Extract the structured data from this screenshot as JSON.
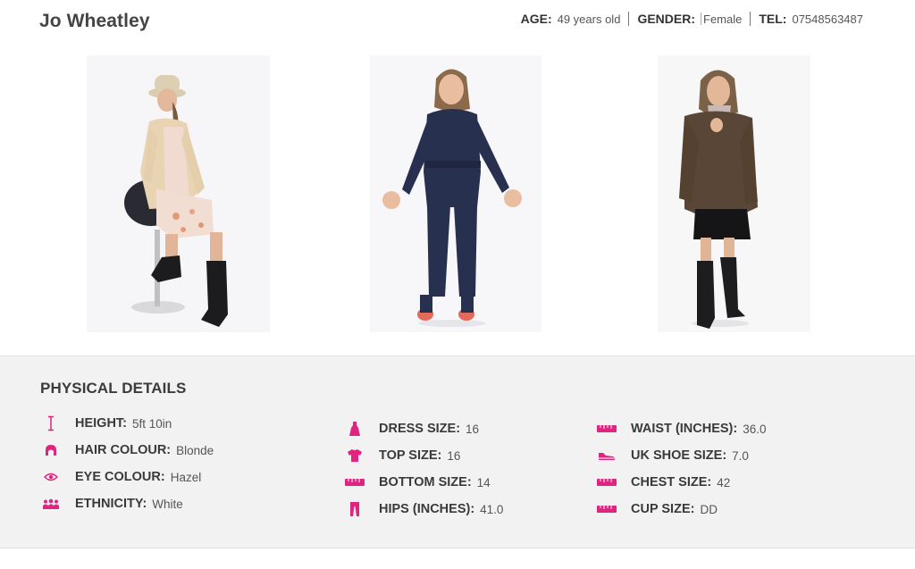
{
  "profile": {
    "name": "Jo Wheatley",
    "age_label": "AGE:",
    "age_value": "49 years old",
    "gender_label": "GENDER:",
    "gender_value": "Female",
    "tel_label": "TEL:",
    "tel_value": "07548563487"
  },
  "photos": [
    {
      "name": "photo-seated"
    },
    {
      "name": "photo-jumpsuit"
    },
    {
      "name": "photo-jacket"
    }
  ],
  "details": {
    "title": "PHYSICAL DETAILS",
    "col1": [
      {
        "label": "HEIGHT:",
        "value": "5ft 10in",
        "icon": "height-icon"
      },
      {
        "label": "HAIR COLOUR:",
        "value": "Blonde",
        "icon": "hair-icon"
      },
      {
        "label": "EYE COLOUR:",
        "value": "Hazel",
        "icon": "eye-icon"
      },
      {
        "label": "ETHNICITY:",
        "value": "White",
        "icon": "people-icon"
      }
    ],
    "col2": [
      {
        "label": "DRESS SIZE:",
        "value": "16",
        "icon": "dress-icon"
      },
      {
        "label": "TOP SIZE:",
        "value": "16",
        "icon": "shirt-icon"
      },
      {
        "label": "BOTTOM SIZE:",
        "value": "14",
        "icon": "tape-measure-icon"
      },
      {
        "label": "HIPS (INCHES):",
        "value": "41.0",
        "icon": "trousers-icon"
      }
    ],
    "col3": [
      {
        "label": "WAIST (INCHES):",
        "value": "36.0",
        "icon": "tape-measure-icon"
      },
      {
        "label": "UK SHOE SIZE:",
        "value": "7.0",
        "icon": "shoe-icon"
      },
      {
        "label": "CHEST SIZE:",
        "value": "42",
        "icon": "tape-measure-icon"
      },
      {
        "label": "CUP SIZE:",
        "value": "DD",
        "icon": "tape-measure-icon"
      }
    ]
  },
  "colors": {
    "accent": "#e0247f",
    "panel": "#f2f2f2"
  }
}
